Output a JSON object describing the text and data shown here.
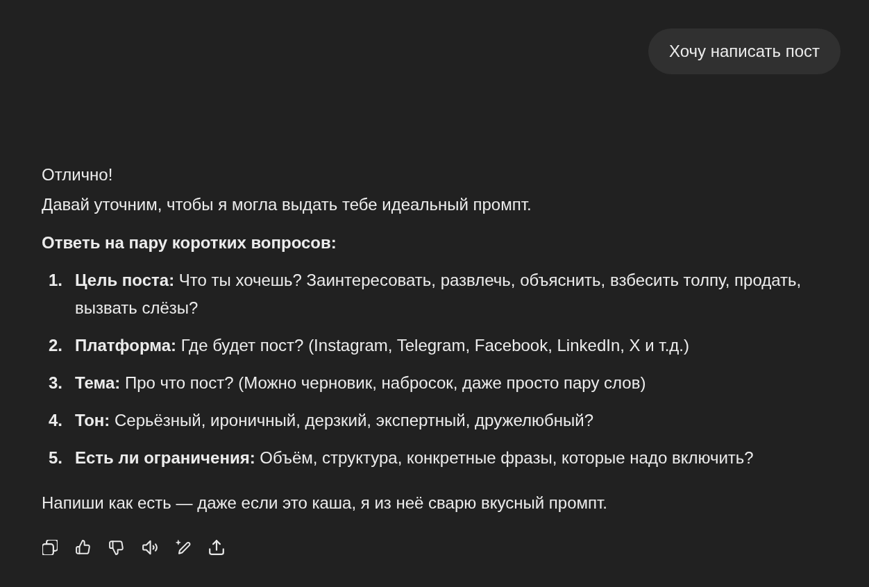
{
  "user_message": {
    "text": "Хочу написать пост"
  },
  "assistant_message": {
    "paragraphs": [
      "Отлично!",
      "Давай уточним, чтобы я могла выдать тебе идеальный промпт."
    ],
    "heading": "Ответь на пару коротких вопросов:",
    "questions": [
      {
        "number": "1.",
        "text": "**Цель поста:** Что ты хочешь? Заинтересовать, развлечь, объяснить, взбесить толпу, продать, вызвать слёзы?"
      },
      {
        "number": "2.",
        "text": "**Платформа:** Где будет пост? (Instagram, Telegram, Facebook, LinkedIn, X и т.д.)"
      },
      {
        "number": "3.",
        "text": "**Тема:** Про что пост? (Можно черновик, набросок, даже просто пару слов)"
      },
      {
        "number": "4.",
        "text": "**Тон:** Серьёзный, ироничный, дерзкий, экспертный, дружелюбный?"
      },
      {
        "number": "5.",
        "text": "**Есть ли ограничения:** Объём, структура, конкретные фразы, которые надо включить?"
      }
    ],
    "closing": "Напиши как есть — даже если это каша, я из неё сварю вкусный промпт."
  }
}
